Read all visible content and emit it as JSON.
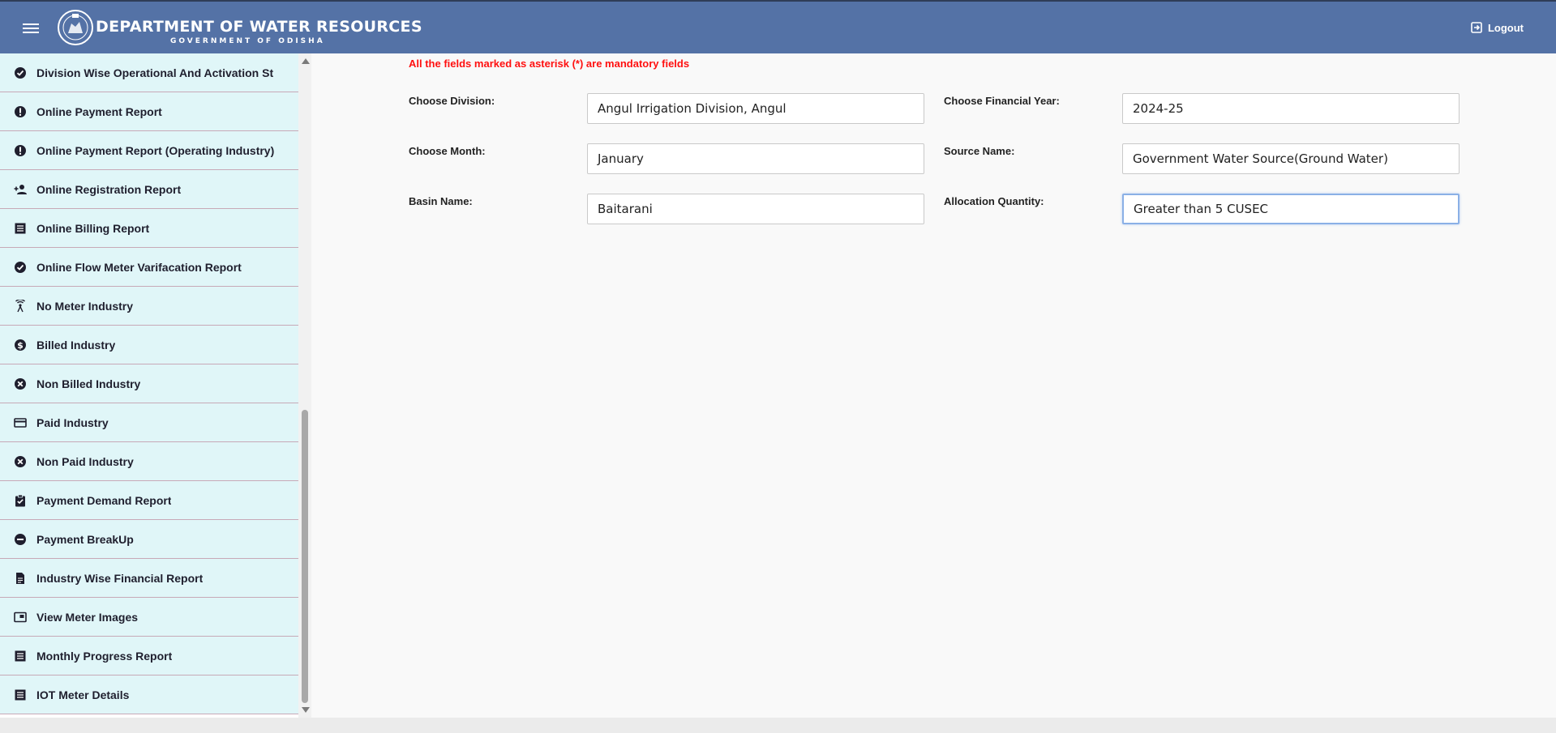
{
  "header": {
    "title": "DEPARTMENT OF WATER RESOURCES",
    "subtitle": "GOVERNMENT OF ODISHA",
    "logout_label": "Logout",
    "bg_color": "#5472a6"
  },
  "sidebar": {
    "items": [
      {
        "label": "Division Wise Operational And Activation St",
        "icon": "check-circle-icon"
      },
      {
        "label": "Online Payment Report",
        "icon": "alert-circle-icon"
      },
      {
        "label": "Online Payment Report (Operating Industry)",
        "icon": "alert-circle-icon"
      },
      {
        "label": "Online Registration Report",
        "icon": "person-add-icon"
      },
      {
        "label": "Online Billing Report",
        "icon": "list-icon"
      },
      {
        "label": "Online Flow Meter Varifacation Report",
        "icon": "check-circle-icon"
      },
      {
        "label": "No Meter Industry",
        "icon": "antenna-icon"
      },
      {
        "label": "Billed Industry",
        "icon": "dollar-circle-icon"
      },
      {
        "label": "Non Billed Industry",
        "icon": "cancel-circle-icon"
      },
      {
        "label": "Paid Industry",
        "icon": "credit-card-icon"
      },
      {
        "label": "Non Paid Industry",
        "icon": "cancel-circle-icon"
      },
      {
        "label": "Payment Demand Report",
        "icon": "clipboard-check-icon"
      },
      {
        "label": "Payment BreakUp",
        "icon": "minus-circle-icon"
      },
      {
        "label": "Industry Wise Financial Report",
        "icon": "document-icon"
      },
      {
        "label": "View Meter Images",
        "icon": "picture-in-picture-icon"
      },
      {
        "label": "Monthly Progress Report",
        "icon": "list-icon"
      },
      {
        "label": "IOT Meter Details",
        "icon": "list-icon"
      }
    ]
  },
  "form": {
    "notice": "All the fields marked as asterisk (*) are mandatory fields",
    "division_label": "Choose Division:",
    "division_value": "Angul Irrigation Division, Angul",
    "fy_label": "Choose Financial Year:",
    "fy_value": "2024-25",
    "month_label": "Choose Month:",
    "month_value": "January",
    "source_label": "Source Name:",
    "source_value": "Government Water Source(Ground Water)",
    "basin_label": "Basin Name:",
    "basin_value": "Baitarani",
    "alloc_label": "Allocation Quantity:",
    "alloc_value": "Greater than 5 CUSEC"
  }
}
